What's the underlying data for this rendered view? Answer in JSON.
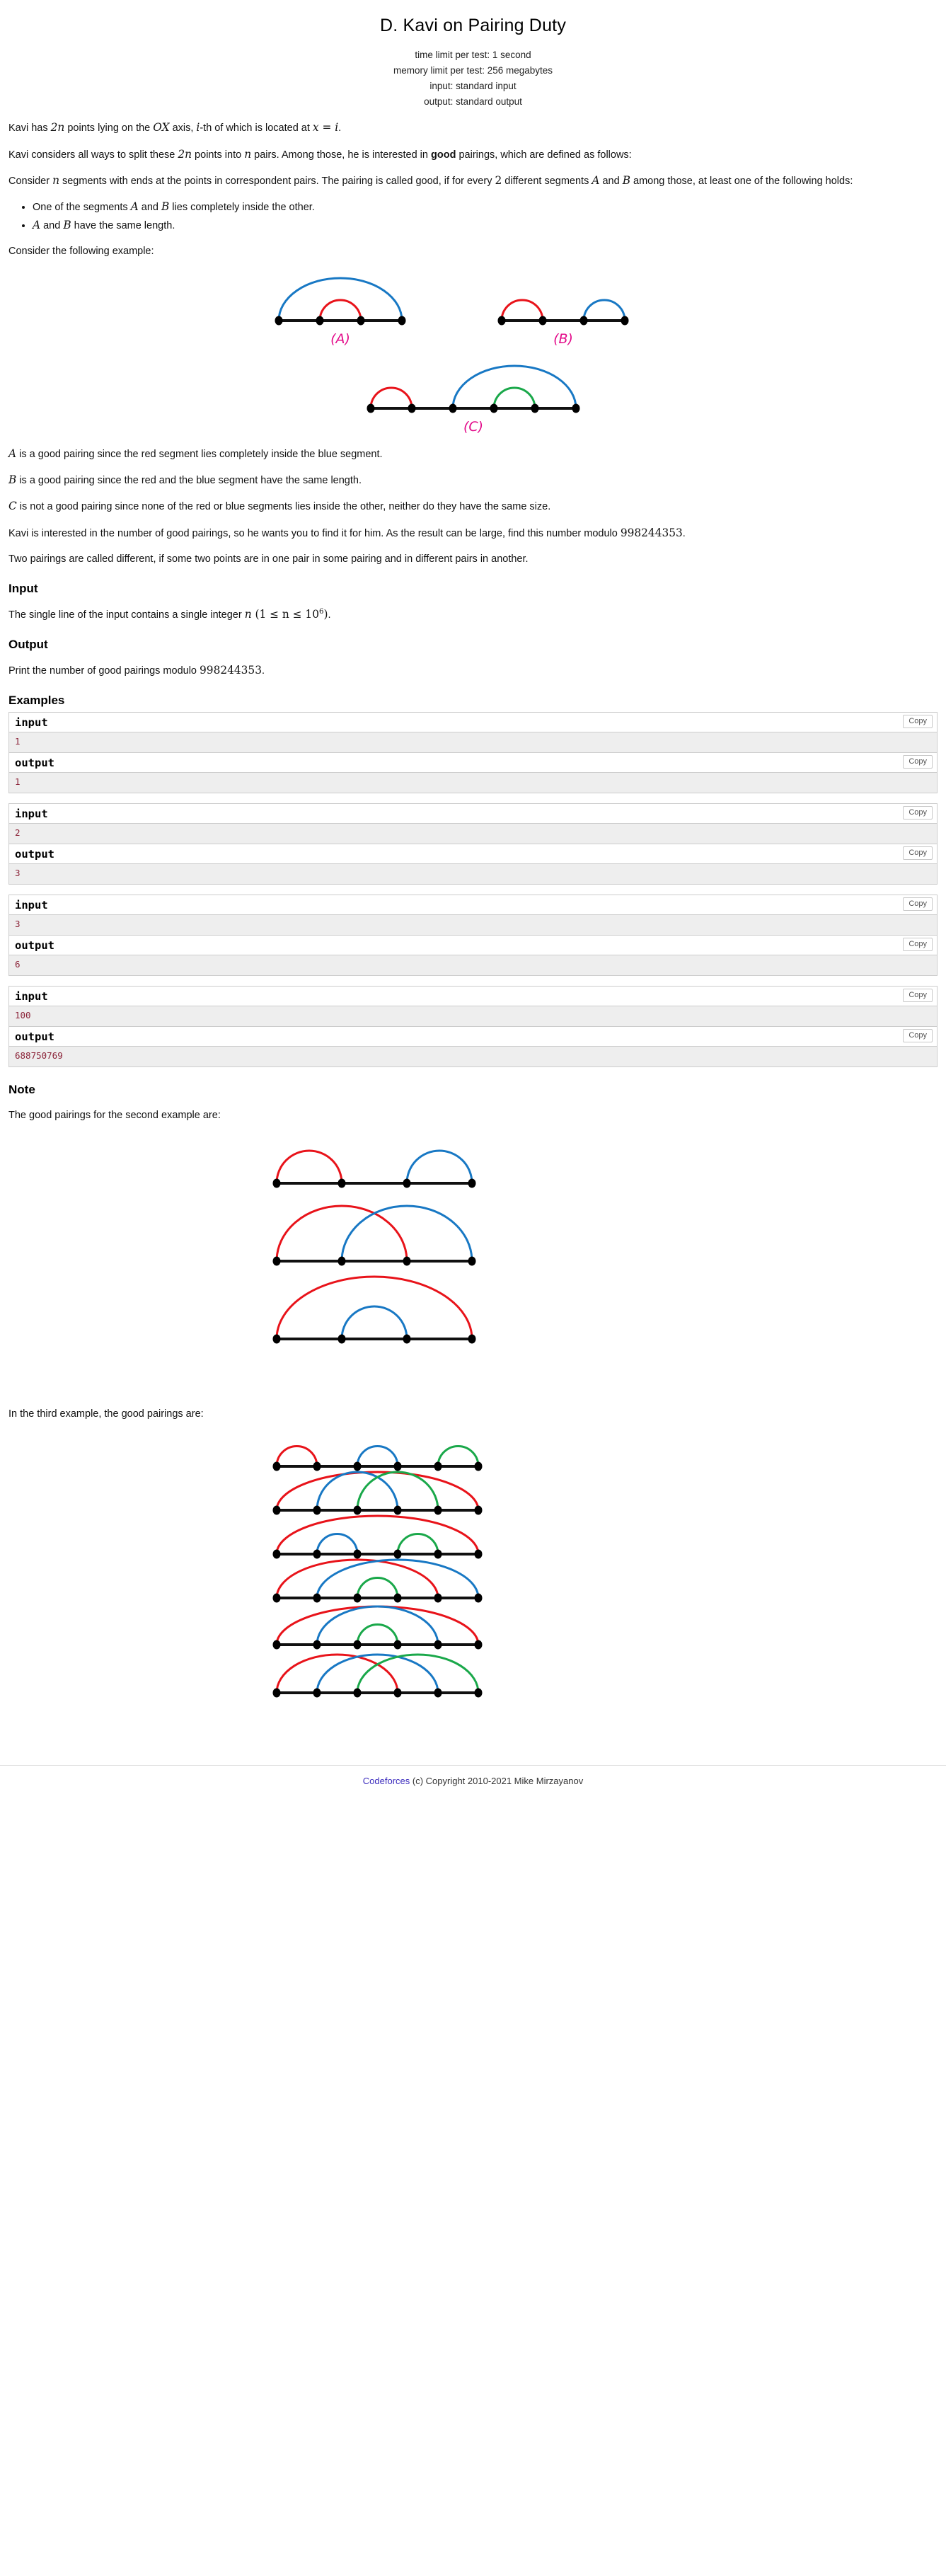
{
  "header": {
    "title": "D. Kavi on Pairing Duty",
    "time_limit": "time limit per test: 1 second",
    "memory_limit": "memory limit per test: 256 megabytes",
    "input_spec": "input: standard input",
    "output_spec": "output: standard output"
  },
  "statement": {
    "p1_a": "Kavi has ",
    "p1_m1": "2n",
    "p1_b": " points lying on the ",
    "p1_m2": "OX",
    "p1_c": " axis, ",
    "p1_m3": "i",
    "p1_d": "-th of which is located at ",
    "p1_m4": "x = i",
    "p1_e": ".",
    "p2_a": "Kavi considers all ways to split these ",
    "p2_m1": "2n",
    "p2_b": " points into ",
    "p2_m2": "n",
    "p2_c": " pairs. Among those, he is interested in ",
    "p2_strong": "good",
    "p2_d": " pairings, which are defined as follows:",
    "p3_a": "Consider ",
    "p3_m1": "n",
    "p3_b": " segments with ends at the points in correspondent pairs. The pairing is called good, if for every ",
    "p3_m2": "2",
    "p3_c": " different segments ",
    "p3_m3": "A",
    "p3_d": " and ",
    "p3_m4": "B",
    "p3_e": " among those, at least one of the following holds:",
    "bullets": [
      {
        "a": "One of the segments ",
        "m1": "A",
        "b": " and ",
        "m2": "B",
        "c": " lies completely inside the other."
      },
      {
        "a": "",
        "m1": "A",
        "b": " and ",
        "m2": "B",
        "c": " have the same length."
      }
    ],
    "example_intro": "Consider the following example:",
    "exp_a": {
      "m": "A",
      "t": " is a good pairing since the red segment lies completely inside the blue segment."
    },
    "exp_b": {
      "m": "B",
      "t": " is a good pairing since the red and the blue segment have the same length."
    },
    "exp_c": {
      "m": "C",
      "t": " is not a good pairing since none of the red or blue segments lies inside the other, neither do they have the same size."
    },
    "p4_a": "Kavi is interested in the number of good pairings, so he wants you to find it for him. As the result can be large, find this number modulo ",
    "p4_mod": "998244353",
    "p4_b": ".",
    "p5": "Two pairings are called different, if some two points are in one pair in some pairing and in different pairs in another."
  },
  "input_section": {
    "title": "Input",
    "a": "The single line of the input contains a single integer ",
    "m_n": "n",
    "m_range_open": " (1 ≤ n ≤ 10",
    "m_exp": "6",
    "m_range_close": ")",
    "b": "."
  },
  "output_section": {
    "title": "Output",
    "a": "Print the number of good pairings modulo ",
    "m_mod": "998244353",
    "b": "."
  },
  "examples_title": "Examples",
  "copy_label": "Copy",
  "input_label": "input",
  "output_label": "output",
  "samples": [
    {
      "input": "1",
      "output": "1"
    },
    {
      "input": "2",
      "output": "3"
    },
    {
      "input": "3",
      "output": "6"
    },
    {
      "input": "100",
      "output": "688750769"
    }
  ],
  "note": {
    "title": "Note",
    "line1": "The good pairings for the second example are:",
    "line2": "In the third example, the good pairings are:"
  },
  "footer": {
    "link": "Codeforces",
    "text": " (c) Copyright 2010-2021 Mike Mirzayanov"
  },
  "colors": {
    "red": "#e8131a",
    "blue": "#1878c4",
    "green": "#1aa84a",
    "magenta": "#e30b8a",
    "axis": "#111111",
    "point": "#000000",
    "sample_value": "#8b2338",
    "link": "#3b2bbd"
  },
  "figures": {
    "example_row1": {
      "labels": [
        "(A)",
        "(B)"
      ],
      "A": {
        "points": 4,
        "arcs": [
          {
            "from": 1,
            "to": 4,
            "color": "blue"
          },
          {
            "from": 2,
            "to": 3,
            "color": "red"
          }
        ]
      },
      "B": {
        "points": 4,
        "arcs": [
          {
            "from": 1,
            "to": 2,
            "color": "red"
          },
          {
            "from": 3,
            "to": 4,
            "color": "blue"
          }
        ]
      }
    },
    "example_row2": {
      "labels": [
        "(C)"
      ],
      "C": {
        "points": 6,
        "arcs": [
          {
            "from": 1,
            "to": 2,
            "color": "red"
          },
          {
            "from": 3,
            "to": 6,
            "color": "blue"
          },
          {
            "from": 4,
            "to": 5,
            "color": "green"
          }
        ]
      }
    },
    "note_n2": [
      {
        "points": 4,
        "arcs": [
          {
            "from": 1,
            "to": 2,
            "color": "red"
          },
          {
            "from": 3,
            "to": 4,
            "color": "blue"
          }
        ]
      },
      {
        "points": 4,
        "arcs": [
          {
            "from": 1,
            "to": 3,
            "color": "red"
          },
          {
            "from": 2,
            "to": 4,
            "color": "blue"
          }
        ]
      },
      {
        "points": 4,
        "arcs": [
          {
            "from": 1,
            "to": 4,
            "color": "red"
          },
          {
            "from": 2,
            "to": 3,
            "color": "blue"
          }
        ]
      }
    ],
    "note_n3": [
      {
        "points": 6,
        "arcs": [
          {
            "from": 1,
            "to": 2,
            "color": "red"
          },
          {
            "from": 3,
            "to": 4,
            "color": "blue"
          },
          {
            "from": 5,
            "to": 6,
            "color": "green"
          }
        ]
      },
      {
        "points": 6,
        "arcs": [
          {
            "from": 1,
            "to": 6,
            "color": "red"
          },
          {
            "from": 2,
            "to": 4,
            "color": "blue"
          },
          {
            "from": 3,
            "to": 5,
            "color": "green"
          }
        ]
      },
      {
        "points": 6,
        "arcs": [
          {
            "from": 1,
            "to": 6,
            "color": "red"
          },
          {
            "from": 2,
            "to": 3,
            "color": "blue"
          },
          {
            "from": 4,
            "to": 5,
            "color": "green"
          }
        ]
      },
      {
        "points": 6,
        "arcs": [
          {
            "from": 1,
            "to": 5,
            "color": "red"
          },
          {
            "from": 2,
            "to": 6,
            "color": "blue"
          },
          {
            "from": 3,
            "to": 4,
            "color": "green"
          }
        ]
      },
      {
        "points": 6,
        "arcs": [
          {
            "from": 1,
            "to": 6,
            "color": "red"
          },
          {
            "from": 2,
            "to": 5,
            "color": "blue"
          },
          {
            "from": 3,
            "to": 4,
            "color": "green"
          }
        ]
      },
      {
        "points": 6,
        "arcs": [
          {
            "from": 1,
            "to": 4,
            "color": "red"
          },
          {
            "from": 2,
            "to": 5,
            "color": "blue"
          },
          {
            "from": 3,
            "to": 6,
            "color": "green"
          }
        ]
      }
    ]
  }
}
